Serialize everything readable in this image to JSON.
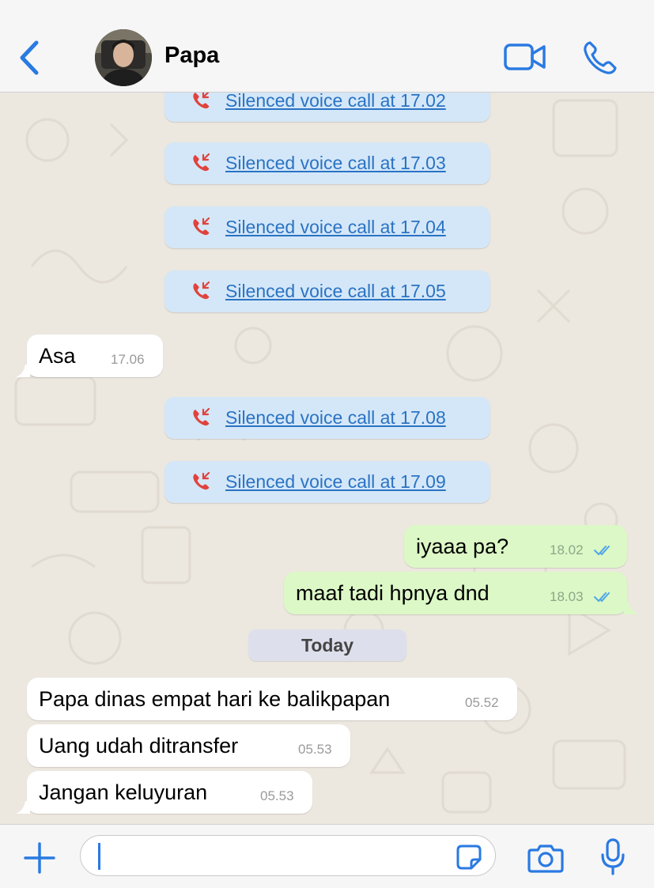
{
  "header": {
    "contact_name": "Papa"
  },
  "colors": {
    "accent": "#2a7ae2",
    "incoming_bubble": "#ffffff",
    "outgoing_bubble": "#dcf8c6",
    "call_pill": "#d4e7f8",
    "missed_call": "#e0433c",
    "chat_background": "#ece7df"
  },
  "calls": [
    {
      "label": "Silenced voice call at 17.02"
    },
    {
      "label": "Silenced voice call at 17.03"
    },
    {
      "label": "Silenced voice call at 17.04"
    },
    {
      "label": "Silenced voice call at 17.05"
    },
    {
      "label": "Silenced voice call at 17.08"
    },
    {
      "label": "Silenced voice call at 17.09"
    }
  ],
  "messages": [
    {
      "direction": "incoming",
      "text": "Asa",
      "time": "17.06"
    },
    {
      "direction": "outgoing",
      "text": "iyaaa pa?",
      "time": "18.02",
      "status": "read"
    },
    {
      "direction": "outgoing",
      "text": "maaf tadi hpnya dnd",
      "time": "18.03",
      "status": "read"
    },
    {
      "direction": "incoming",
      "text": "Papa dinas empat hari ke balikpapan",
      "time": "05.52"
    },
    {
      "direction": "incoming",
      "text": "Uang udah ditransfer",
      "time": "05.53"
    },
    {
      "direction": "incoming",
      "text": "Jangan keluyuran",
      "time": "05.53"
    }
  ],
  "date_separator": "Today",
  "composer": {
    "value": "",
    "placeholder": ""
  },
  "icons": [
    "chevron-left-icon",
    "video-call-icon",
    "phone-icon",
    "missed-call-icon",
    "double-check-icon",
    "plus-icon",
    "sticker-icon",
    "camera-icon",
    "microphone-icon"
  ]
}
